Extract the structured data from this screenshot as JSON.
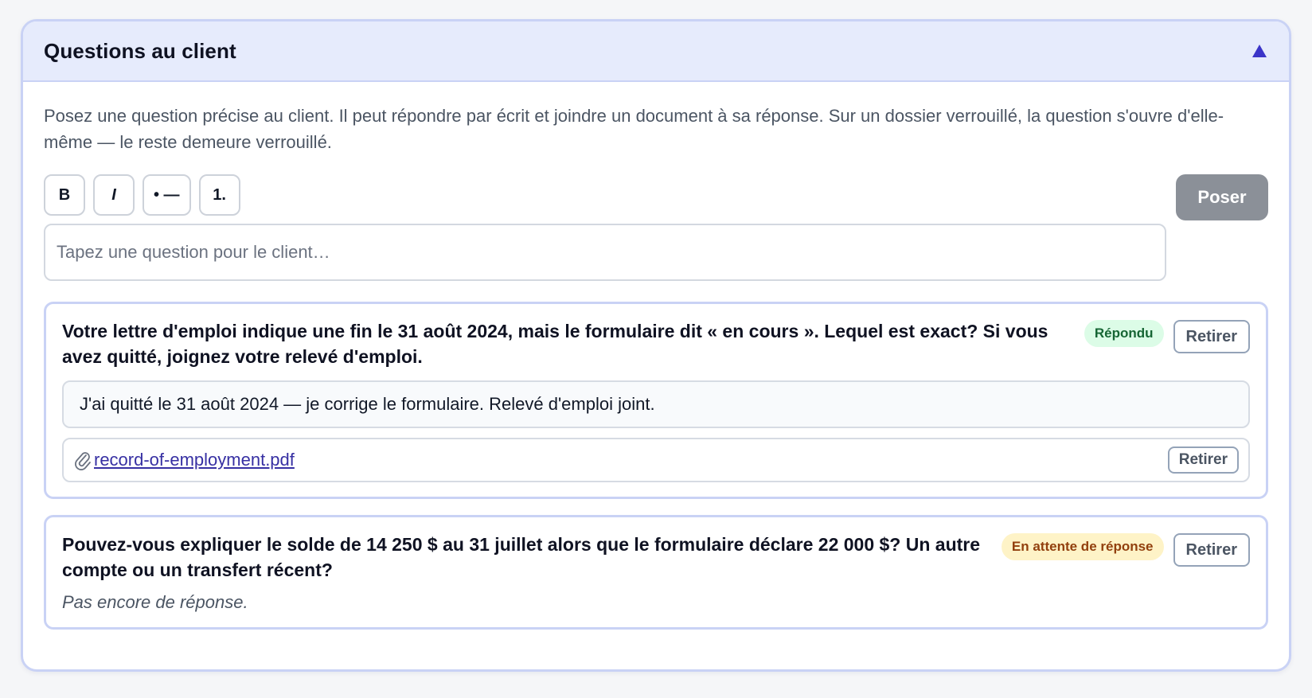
{
  "panel": {
    "title": "Questions au client",
    "toggle_icon": "triangle-up-icon",
    "help_text": "Posez une question précise au client. Il peut répondre par écrit et joindre un document à sa réponse. Sur un dossier verrouillé, la question s'ouvre d'elle-même — le reste demeure verrouillé."
  },
  "composer": {
    "toolbar": {
      "bold": "B",
      "italic": "I",
      "bullet_list": "• —",
      "numbered_list": "1."
    },
    "placeholder": "Tapez une question pour le client…",
    "submit_label": "Poser"
  },
  "questions": [
    {
      "text_before": "Votre lettre d'emploi indique une fin le ",
      "text_bold": "31 août 2024",
      "text_after": ", mais le formulaire dit « en cours ». Lequel est exact? Si vous avez quitté, joignez votre relevé d'emploi.",
      "status": "Répondu",
      "remove_label": "Retirer",
      "answer": "J'ai quitté le 31 août 2024 — je corrige le formulaire. Relevé d'emploi joint.",
      "attachment": {
        "icon": "paperclip-icon",
        "name": "record-of-employment.pdf",
        "remove_label": "Retirer"
      }
    },
    {
      "text_before": "Pouvez-vous expliquer le solde de ",
      "text_bold": "14 250 $",
      "text_after": " au 31 juillet alors que le formulaire déclare 22 000 $? Un autre compte ou un transfert récent?",
      "status": "En attente de réponse",
      "remove_label": "Retirer",
      "no_answer": "Pas encore de réponse."
    }
  ],
  "colors": {
    "accent": "#3b34c8",
    "header_bg": "#e6ebfc",
    "border": "#c9d2f5",
    "answered_bg": "#dcfce7",
    "answered_fg": "#166534",
    "pending_bg": "#fef3c7",
    "pending_fg": "#92400e",
    "submit_bg": "#8b9098",
    "link": "#3730a3"
  }
}
